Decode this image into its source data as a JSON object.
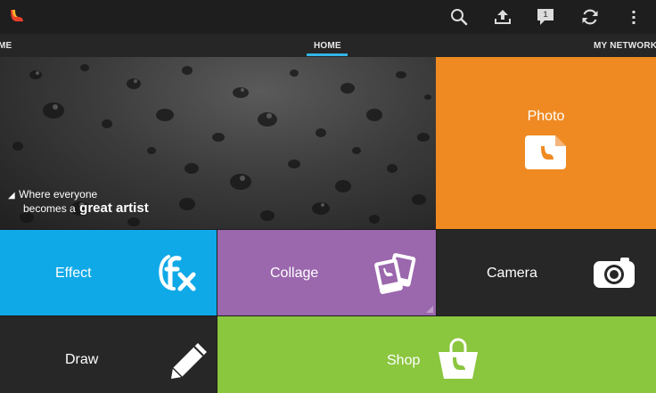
{
  "toolbar": {
    "notification_count": "1",
    "icons": [
      "app-logo-icon",
      "search-icon",
      "upload-icon",
      "notifications-icon",
      "sync-icon",
      "overflow-menu-icon"
    ]
  },
  "tabs": [
    {
      "label": "ME",
      "active": false
    },
    {
      "label": "HOME",
      "active": true
    },
    {
      "label": "MY NETWORK",
      "active": false
    }
  ],
  "hero": {
    "line1": "Where everyone",
    "line2_prefix": "becomes a",
    "line2_emphasis": "great artist"
  },
  "tiles": [
    {
      "label": "Photo",
      "color": "#ef8a22",
      "icon": "photo-icon"
    },
    {
      "label": "Effect",
      "color": "#10a9e8",
      "icon": "fx-icon"
    },
    {
      "label": "Collage",
      "color": "#9b67ad",
      "icon": "collage-icon"
    },
    {
      "label": "Camera",
      "color": "#272727",
      "icon": "camera-icon"
    },
    {
      "label": "Draw",
      "color": "#272727",
      "icon": "pencil-icon"
    },
    {
      "label": "Shop",
      "color": "#8bc63f",
      "icon": "shopping-bag-icon"
    }
  ]
}
